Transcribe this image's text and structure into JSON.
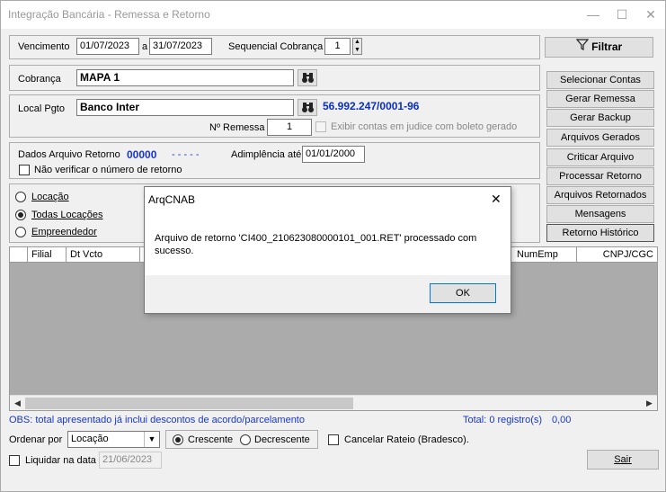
{
  "window": {
    "title": "Integração Bancária - Remessa e Retorno",
    "minimize": "—",
    "maximize": "☐",
    "close": "✕"
  },
  "filter": {
    "vencimento_label": "Vencimento",
    "date_from": "01/07/2023",
    "date_sep": "a",
    "date_to": "31/07/2023",
    "sequencial_label": "Sequencial Cobrança",
    "sequencial_value": "1",
    "filtrar_label": "Filtrar"
  },
  "cobranca": {
    "label": "Cobrança",
    "value": "MAPA 1"
  },
  "local": {
    "label": "Local Pgto",
    "value": "Banco Inter",
    "cnpj": "56.992.247/0001-96",
    "remessa_label": "Nº Remessa",
    "remessa_value": "1",
    "exibir_label": "Exibir contas em judice com boleto gerado"
  },
  "retorno": {
    "label": "Dados Arquivo Retorno",
    "value": "00000",
    "dashes": "- - - - -",
    "adimplencia_label": "Adimplência até",
    "adimplencia_value": "01/01/2000",
    "nao_verificar_label": "Não verificar o número de retorno"
  },
  "scope": {
    "locacao_label": "Locação",
    "todas_label": "Todas Locações",
    "empreendedor_label": "Empreendedor"
  },
  "side_buttons": {
    "selecionar": "Selecionar Contas",
    "gerar_remessa": "Gerar Remessa",
    "gerar_backup": "Gerar Backup",
    "arquivos_gerados": "Arquivos Gerados",
    "criticar": "Criticar Arquivo",
    "processar": "Processar Retorno",
    "retornados": "Arquivos Retornados",
    "mensagens": "Mensagens",
    "historico": "Retorno Histórico"
  },
  "grid": {
    "columns": [
      "Filial",
      "Dt Vcto",
      "NumEmp",
      "CNPJ/CGC"
    ]
  },
  "status": {
    "obs": "OBS: total apresentado já inclui descontos de acordo/parcelamento",
    "total_label": "Total: 0 registro(s)",
    "total_value": "0,00"
  },
  "bottom": {
    "ordenar_label": "Ordenar por",
    "ordenar_value": "Locação",
    "crescente_label": "Crescente",
    "decrescente_label": "Decrescente",
    "cancelar_label": "Cancelar Rateio (Bradesco).",
    "liquidar_label": "Liquidar na data",
    "liquidar_value": "21/06/2023",
    "sair_label": "Sair"
  },
  "dialog": {
    "title": "ArqCNAB",
    "close": "✕",
    "message": "Arquivo de retorno 'CI400_210623080000101_001.RET' processado com sucesso.",
    "ok_label": "OK"
  }
}
